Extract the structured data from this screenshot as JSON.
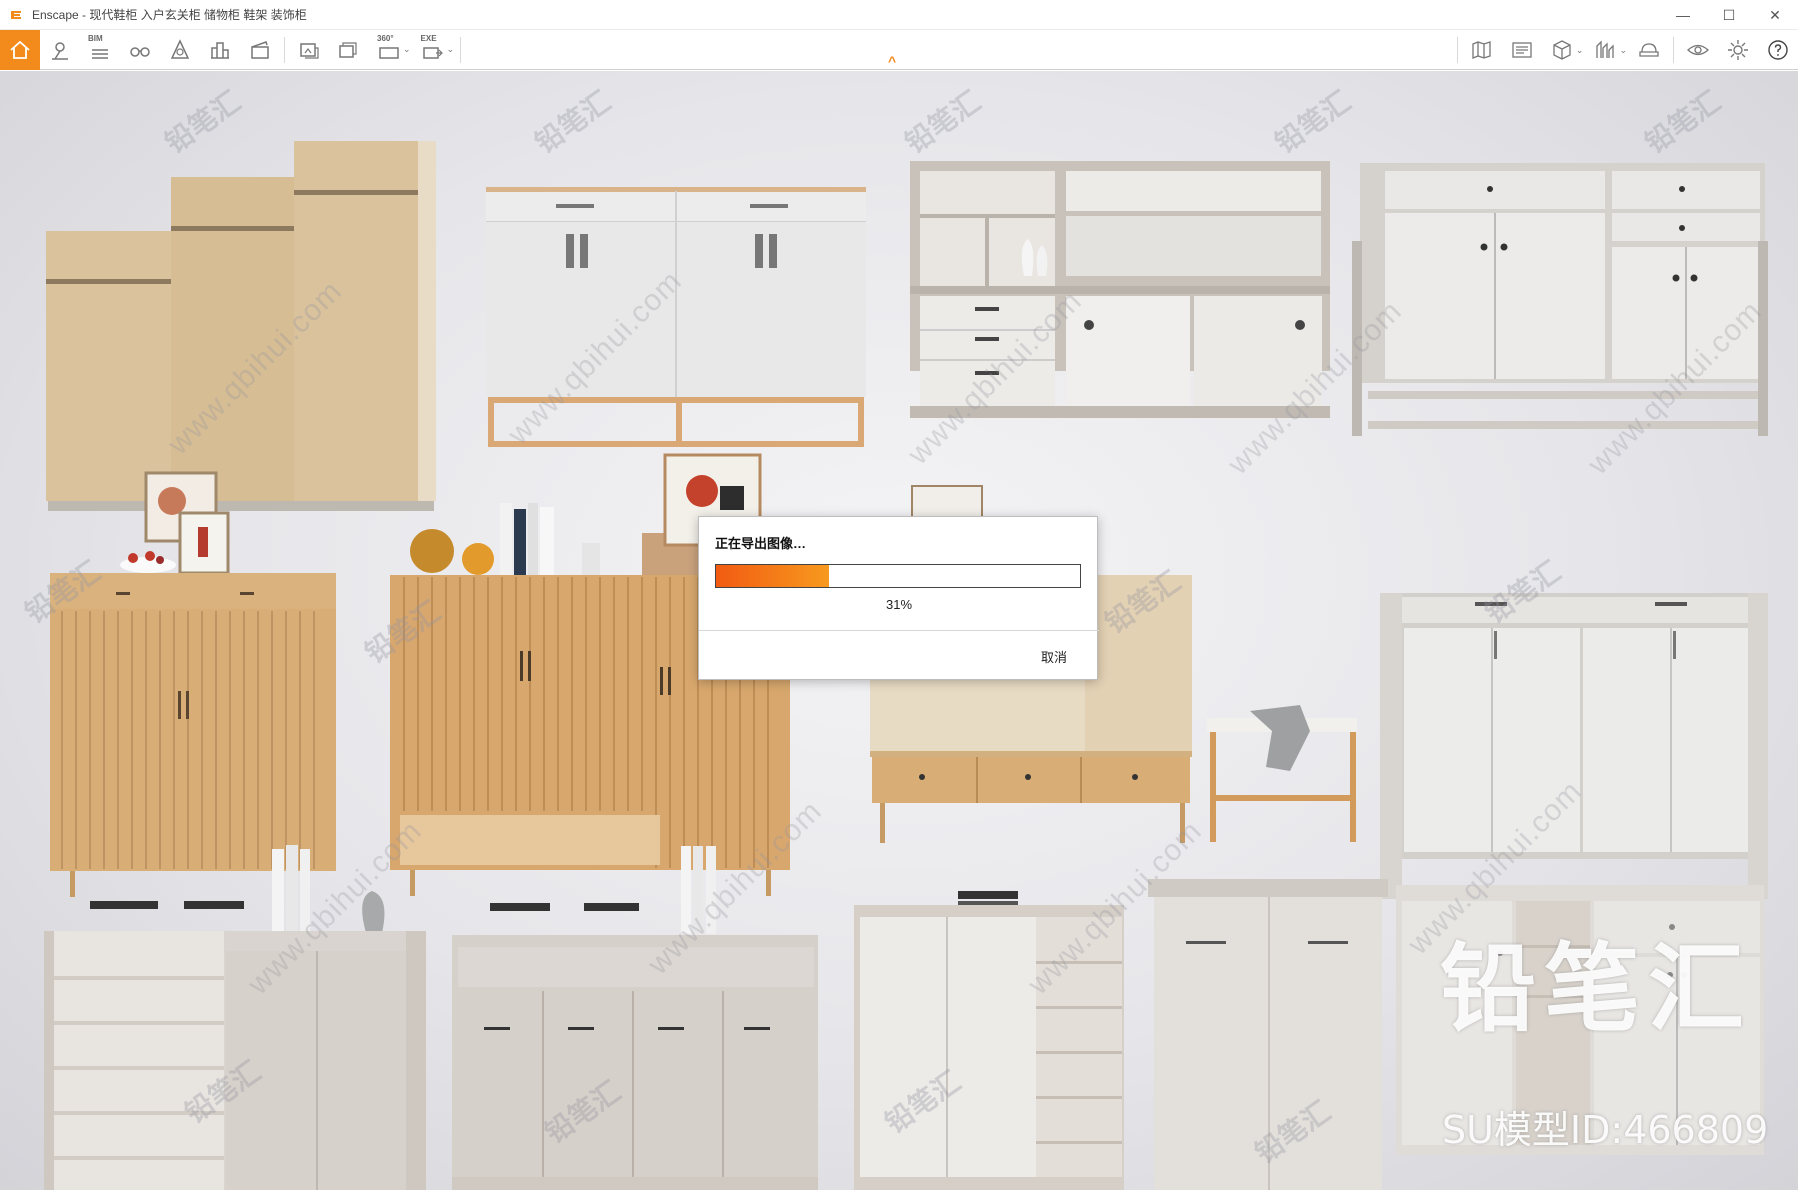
{
  "window": {
    "title": "Enscape - 现代鞋柜 入户玄关柜 储物柜 鞋架 装饰柜",
    "minimize_glyph": "—",
    "maximize_glyph": "☐",
    "close_glyph": "✕"
  },
  "toolbar": {
    "left_icons": [
      "home-icon",
      "location-pin-icon",
      "bim-list-icon",
      "binoculars-icon",
      "assets-icon",
      "buildings-icon",
      "clapper-icon",
      "screenshot-icon",
      "batch-render-icon",
      "panorama-360-icon",
      "export-exe-icon"
    ],
    "bim_badge": "BIM",
    "pano_badge": "360°",
    "exe_badge": "EXE",
    "right_icons": [
      "map-icon",
      "settings-panel-icon",
      "cube-icon",
      "chart-icon",
      "hat-icon",
      "eye-icon",
      "gear-icon",
      "help-icon"
    ],
    "active": "home-icon",
    "accent_color": "#f38a1c"
  },
  "viewport": {
    "watermark_text": "铅笔汇",
    "watermark_url": "www.qbihui.com",
    "brand_name": "铅笔汇",
    "model_id": "SU模型ID:466809"
  },
  "dialog": {
    "title": "正在导出图像…",
    "progress": 0.31,
    "progress_label": "31%",
    "cancel_label": "取消",
    "fill_color": "#f25b12"
  }
}
